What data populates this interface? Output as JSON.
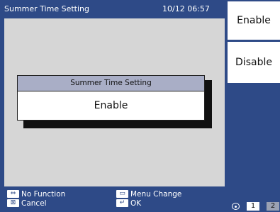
{
  "header": {
    "title": "Summer Time Setting",
    "datetime": "10/12 06:57"
  },
  "dialog": {
    "title": "Summer Time Setting",
    "value": "Enable"
  },
  "softkeys": [
    {
      "label": "Enable"
    },
    {
      "label": "Disable"
    }
  ],
  "hints": [
    {
      "icon": "left-right-arrows-icon",
      "label": "No Function"
    },
    {
      "icon": "cancel-icon",
      "label": "Cancel"
    },
    {
      "icon": "menu-icon",
      "label": "Menu Change"
    },
    {
      "icon": "enter-icon",
      "label": "OK"
    }
  ],
  "pager": {
    "pages": [
      "1",
      "2"
    ],
    "current": "1"
  },
  "colors": {
    "background": "#2e4a87",
    "panel": "#d6d6d6",
    "dialog_header": "#a9aec6"
  }
}
